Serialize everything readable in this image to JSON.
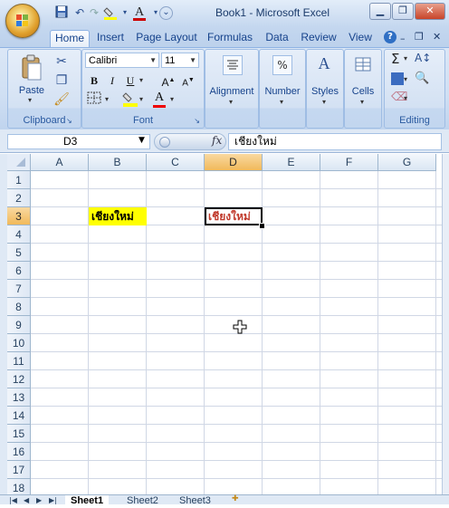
{
  "window": {
    "title": "Book1 - Microsoft Excel",
    "minimize_icon": "minimize-icon",
    "maximize_icon": "restore-icon",
    "close_icon": "close-icon"
  },
  "quick_access": [
    "save-icon",
    "undo-icon",
    "redo-icon",
    "fill-color-icon",
    "font-color-icon",
    "customize-icon"
  ],
  "tabs": [
    {
      "label": "Home",
      "active": true
    },
    {
      "label": "Insert"
    },
    {
      "label": "Page Layout"
    },
    {
      "label": "Formulas"
    },
    {
      "label": "Data"
    },
    {
      "label": "Review"
    },
    {
      "label": "View"
    }
  ],
  "ribbon": {
    "clipboard": {
      "label": "Clipboard",
      "paste_label": "Paste"
    },
    "font": {
      "label": "Font",
      "font_name": "Calibri",
      "font_size": "11",
      "bold": "B",
      "italic": "I",
      "underline": "U"
    },
    "alignment": {
      "label": "Alignment"
    },
    "number": {
      "label": "Number"
    },
    "styles": {
      "label": "Styles"
    },
    "cells": {
      "label": "Cells"
    },
    "editing": {
      "label": "Editing"
    }
  },
  "formula_bar": {
    "name_box": "D3",
    "fx": "fx",
    "content": "เชียงใหม่"
  },
  "grid": {
    "columns": [
      "A",
      "B",
      "C",
      "D",
      "E",
      "F",
      "G"
    ],
    "selected_column": "D",
    "rows": [
      "1",
      "2",
      "3",
      "4",
      "5",
      "6",
      "7",
      "8",
      "9",
      "10",
      "11",
      "12",
      "13",
      "14",
      "15",
      "16",
      "17",
      "18"
    ],
    "selected_row": "3",
    "cells": {
      "B3": {
        "value": "เชียงใหม่",
        "fill": "#ffff00",
        "color": "#000000"
      },
      "D3": {
        "value": "เชียงใหม่",
        "color": "#c0392b",
        "selected": true
      }
    }
  },
  "sheets": [
    "Sheet1",
    "Sheet2",
    "Sheet3"
  ],
  "active_sheet": "Sheet1",
  "colors": {
    "selection_header": "#f1b95a",
    "ribbon_bg": "#cfdff3"
  }
}
